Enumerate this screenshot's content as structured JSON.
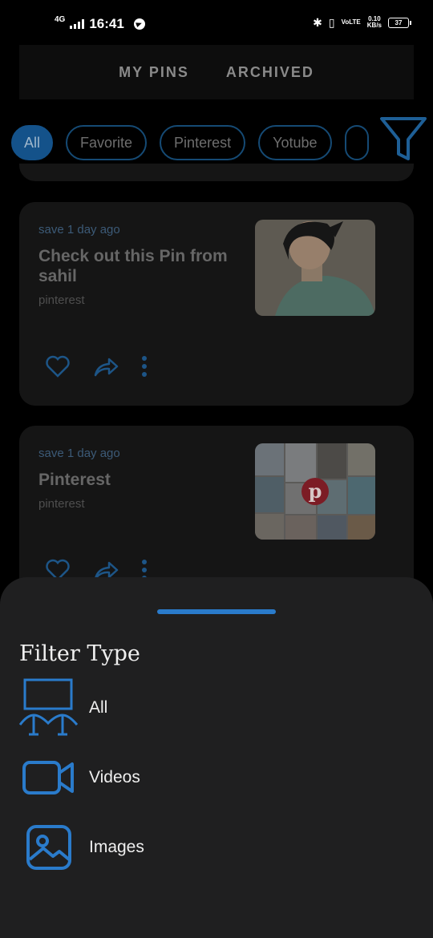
{
  "status_bar": {
    "network": "4G",
    "time": "16:41",
    "volte": "VoLTE",
    "speed": "0.10",
    "speed_unit": "KB/s",
    "battery": "37"
  },
  "tabs": [
    "MY PINS",
    "ARCHIVED"
  ],
  "chips": [
    "All",
    "Favorite",
    "Pinterest",
    "Yotube"
  ],
  "active_chip": "All",
  "cards": [
    {
      "time": "save 1 day ago",
      "title": "Check out this Pin from sahil",
      "source": "pinterest",
      "thumb": "anime-character-image"
    },
    {
      "time": "save 1 day ago",
      "title": "Pinterest",
      "source": "pinterest",
      "thumb": "pinterest-collage-image"
    }
  ],
  "sheet": {
    "title": "Filter Type",
    "options": [
      {
        "label": "All",
        "icon": "gallery-frame-icon"
      },
      {
        "label": "Videos",
        "icon": "video-camera-icon"
      },
      {
        "label": "Images",
        "icon": "image-icon"
      }
    ]
  },
  "colors": {
    "accent": "#2a7bcb",
    "sheet_bg": "#1f1f20",
    "card_bg": "#151515"
  }
}
